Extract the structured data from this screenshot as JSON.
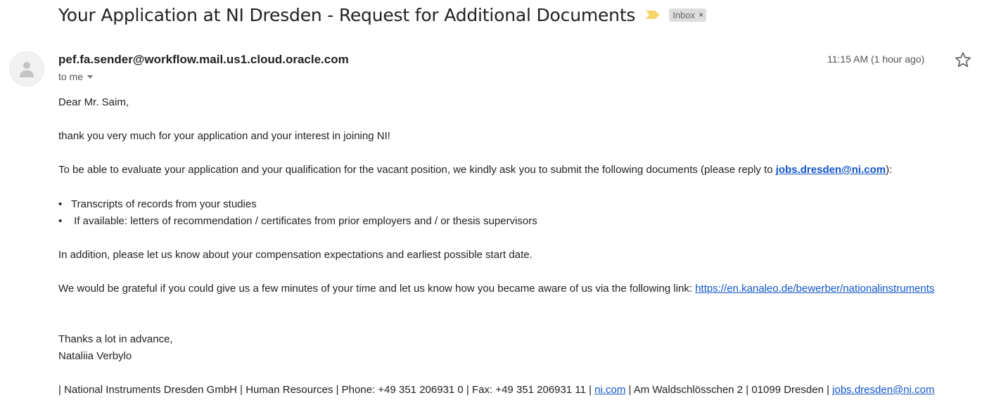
{
  "email": {
    "subject": "Your Application at NI Dresden - Request for Additional Documents",
    "label": "Inbox",
    "label_remove": "×",
    "sender": "pef.fa.sender@workflow.mail.us1.cloud.oracle.com",
    "to": "to me",
    "time": "11:15 AM (1 hour ago)"
  },
  "icons": {
    "avatar": "default-avatar-icon",
    "importance": "importance-marker-icon",
    "star": "star-icon",
    "importance_color": "#f7d46a"
  },
  "body": {
    "greeting": "Dear Mr. Saim,",
    "thanks_line": "thank you very much for your application and your interest in joining NI!",
    "request_text": "To be able to evaluate your application and your qualification for the vacant position, we kindly ask you to submit the following documents (please reply to ",
    "request_email": "jobs.dresden@ni.com",
    "request_end": "):",
    "bullets": [
      "Transcripts of records from your studies",
      " If available: letters of recommendation / certificates from prior employers and / or thesis supervisors"
    ],
    "bullet_char": "•",
    "addition": "In addition, please let us know about your compensation expectations and earliest possible start date.",
    "survey_text": "We would be grateful if you could give us a few minutes of your time and let us know how you became aware of us via the following link: ",
    "survey_link": "https://en.kanaleo.de/bewerber/nationalinstruments",
    "closing": "Thanks a lot in advance,",
    "signer": "Nataliia Verbylo",
    "footer_prefix": "| National Instruments Dresden GmbH | Human Resources | Phone: +49 351 206931 0 | Fax: +49 351 206931 11 | ",
    "footer_link1": "ni.com",
    "footer_middle": " | Am Waldschlösschen 2 | 01099 Dresden | ",
    "footer_link2": "jobs.dresden@ni.com"
  }
}
